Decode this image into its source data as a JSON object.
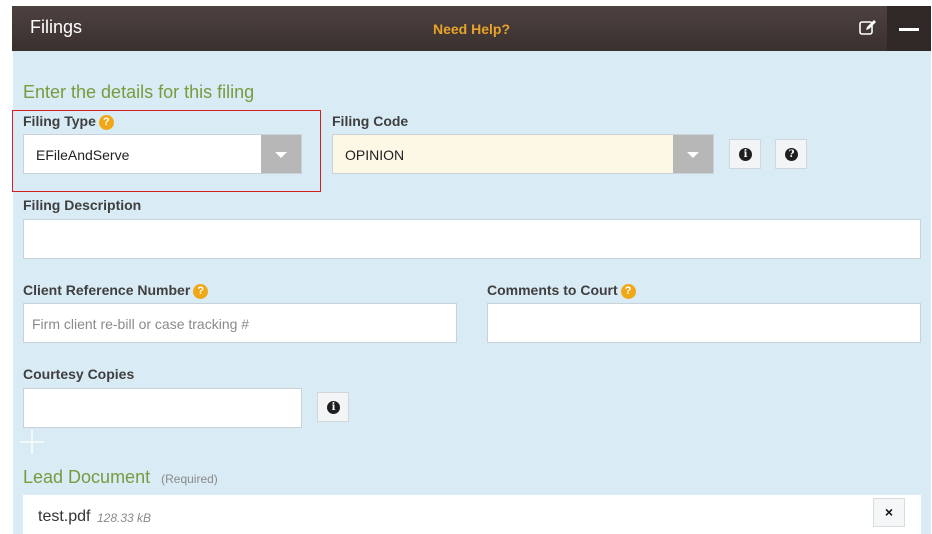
{
  "header": {
    "title": "Filings",
    "help_link": "Need Help?"
  },
  "form": {
    "section_title": "Enter the details for this filing",
    "filing_type": {
      "label": "Filing Type",
      "value": "EFileAndServe"
    },
    "filing_code": {
      "label": "Filing Code",
      "value": "OPINION"
    },
    "filing_description": {
      "label": "Filing Description",
      "value": ""
    },
    "client_reference": {
      "label": "Client Reference Number",
      "placeholder": "Firm client re-bill or case tracking #"
    },
    "comments_to_court": {
      "label": "Comments to Court",
      "value": ""
    },
    "courtesy_copies": {
      "label": "Courtesy Copies",
      "value": ""
    },
    "lead_document": {
      "title": "Lead Document",
      "required": "(Required)",
      "file_name": "test.pdf",
      "file_size": "128.33 kB"
    }
  },
  "icons": {
    "help": "?",
    "info": "i",
    "remove": "×"
  },
  "colors": {
    "header": "#3f3533",
    "panel": "#d9ebf4",
    "accent": "#e7a32a",
    "section": "#7a9a40",
    "highlight": "#d42020"
  }
}
